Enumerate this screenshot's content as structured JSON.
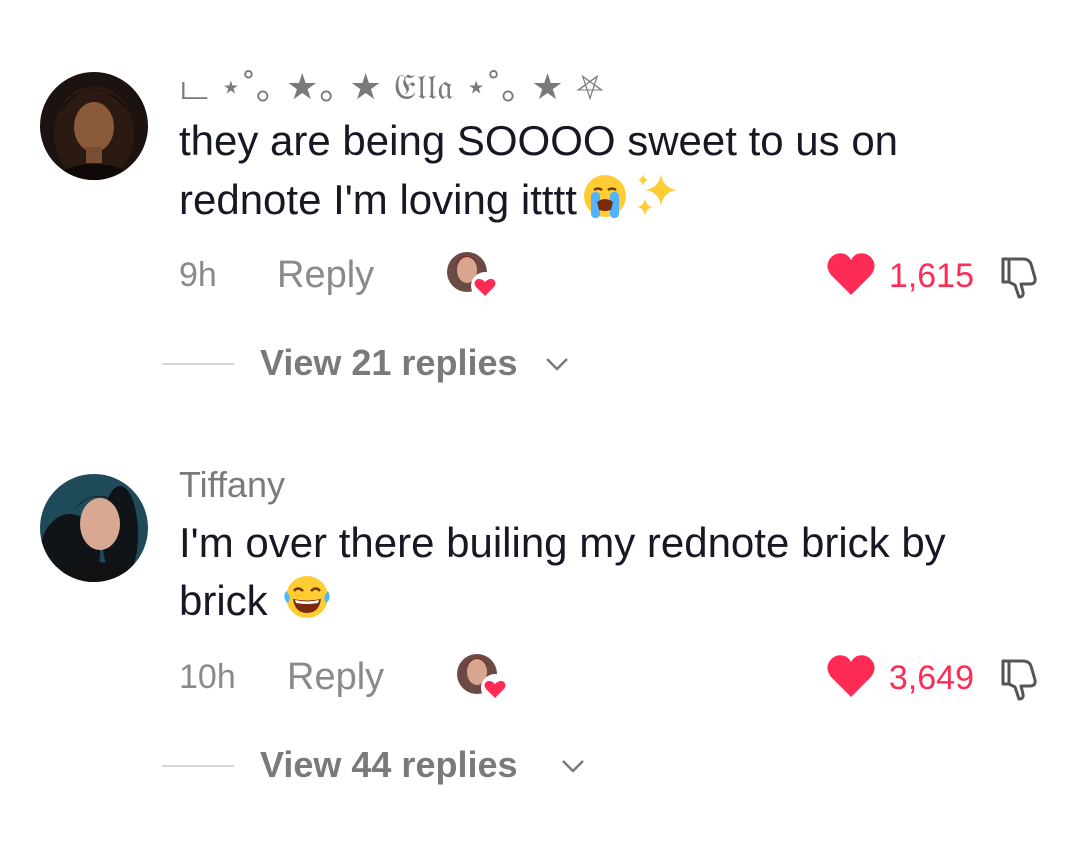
{
  "comments": [
    {
      "username": "ட ⋆˚｡ ★｡ ★ 𝔈𝔩𝔩𝔞 ⋆˚｡ ★ ⛧",
      "text": "they are being SOOOO sweet to us on rednote I'm loving itttt",
      "emoji": "loudly-crying-face, sparkles",
      "time": "9h",
      "reply_label": "Reply",
      "likes": "1,615",
      "liked": true,
      "view_replies": "View 21 replies"
    },
    {
      "username": "Tiffany",
      "text": "I'm over there builing my rednote brick by brick",
      "emoji": "face-with-tears-of-joy",
      "time": "10h",
      "reply_label": "Reply",
      "likes": "3,649",
      "liked": true,
      "view_replies": "View 44 replies"
    }
  ],
  "colors": {
    "like": "#fe2c55",
    "secondary_text": "#8a8a8a",
    "primary_text": "#161823"
  }
}
